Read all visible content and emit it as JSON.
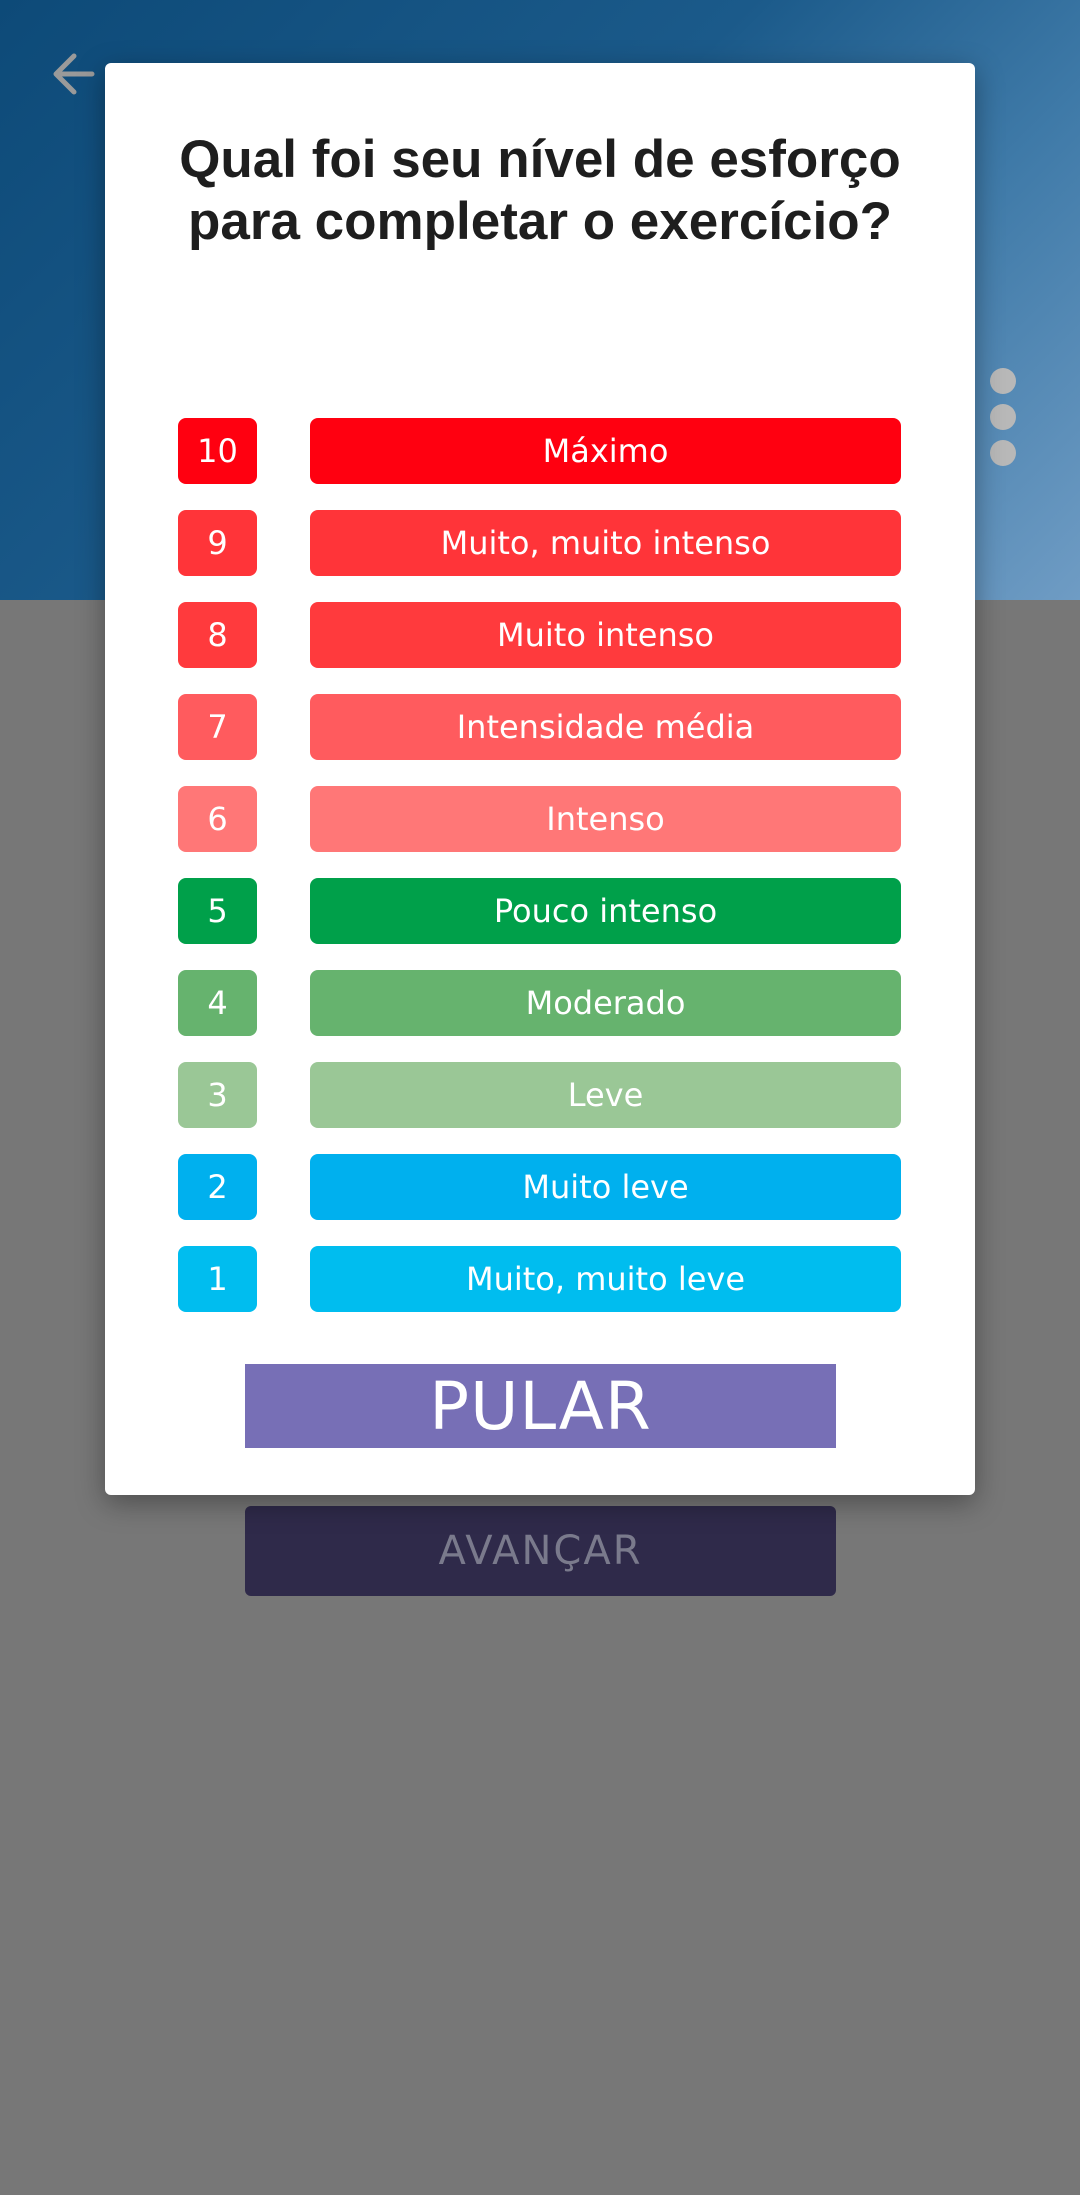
{
  "background": {
    "advance_label": "AVANÇAR"
  },
  "modal": {
    "title": "Qual foi seu nível de esforço para completar o exercício?",
    "skip_label": "PULAR",
    "scale": [
      {
        "number": "10",
        "label": "Máximo",
        "color": "#ff0010"
      },
      {
        "number": "9",
        "label": "Muito, muito intenso",
        "color": "#ff3439"
      },
      {
        "number": "8",
        "label": "Muito intenso",
        "color": "#ff3a3d"
      },
      {
        "number": "7",
        "label": "Intensidade média",
        "color": "#ff5b5e"
      },
      {
        "number": "6",
        "label": "Intenso",
        "color": "#ff7777"
      },
      {
        "number": "5",
        "label": "Pouco intenso",
        "color": "#00a04a"
      },
      {
        "number": "4",
        "label": "Moderado",
        "color": "#66b36e"
      },
      {
        "number": "3",
        "label": "Leve",
        "color": "#9ac796"
      },
      {
        "number": "2",
        "label": "Muito leve",
        "color": "#00b0ee"
      },
      {
        "number": "1",
        "label": "Muito, muito leve",
        "color": "#00bdef"
      }
    ]
  },
  "icons": {
    "back": "arrow-left-icon",
    "more": "more-vertical-icon"
  }
}
